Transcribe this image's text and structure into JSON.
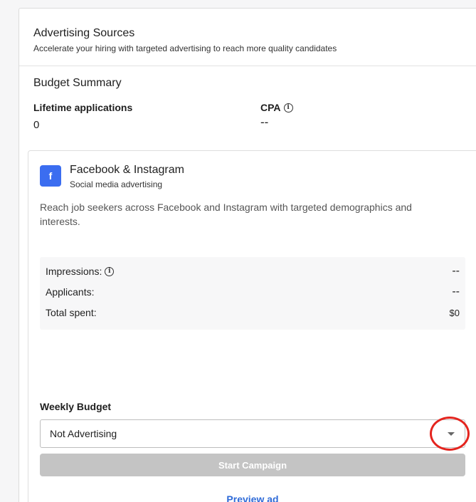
{
  "header": {
    "title": "Advertising Sources",
    "subtitle": "Accelerate your hiring with targeted advertising to reach more quality candidates"
  },
  "budget_summary": {
    "title": "Budget Summary",
    "lifetime_label": "Lifetime applications",
    "lifetime_value": "0",
    "cpa_label": "CPA",
    "cpa_value": "--"
  },
  "card": {
    "logo_letter": "f",
    "title": "Facebook & Instagram",
    "subtitle": "Social media advertising",
    "description": "Reach job seekers across Facebook and Instagram with targeted demographics and interests.",
    "metrics": {
      "impressions_label": "Impressions:",
      "impressions_value": "--",
      "applicants_label": "Applicants:",
      "applicants_value": "--",
      "spent_label": "Total spent:",
      "spent_value": "$0"
    },
    "weekly_budget_label": "Weekly Budget",
    "weekly_budget_selected": "Not Advertising",
    "start_button": "Start Campaign",
    "preview_link": "Preview ad"
  },
  "icons": {
    "info": "info-icon",
    "caret": "chevron-down-icon",
    "logo": "facebook-logo-icon"
  },
  "colors": {
    "brand_blue": "#3b6df0",
    "link_blue": "#2f6bd8",
    "disabled_button": "#c4c4c4",
    "annotation_red": "#e4241e"
  }
}
